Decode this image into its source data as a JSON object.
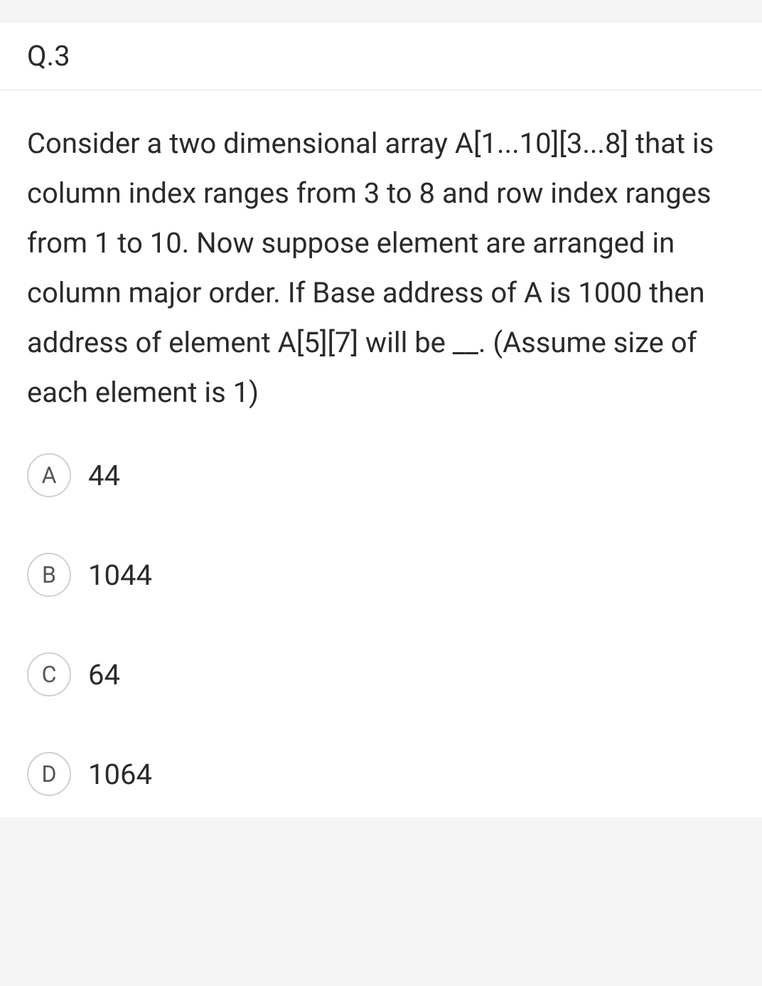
{
  "question": {
    "number": "Q.3",
    "text": "Consider a two dimensional array A[1...10][3...8] that is column index ranges from 3 to 8 and row index ranges from 1 to 10. Now suppose element are arranged in column major order. If Base address of A is 1000 then address of element A[5][7] will be __. (Assume size of each element is 1)"
  },
  "options": [
    {
      "letter": "A",
      "text": "44"
    },
    {
      "letter": "B",
      "text": "1044"
    },
    {
      "letter": "C",
      "text": "64"
    },
    {
      "letter": "D",
      "text": "1064"
    }
  ]
}
